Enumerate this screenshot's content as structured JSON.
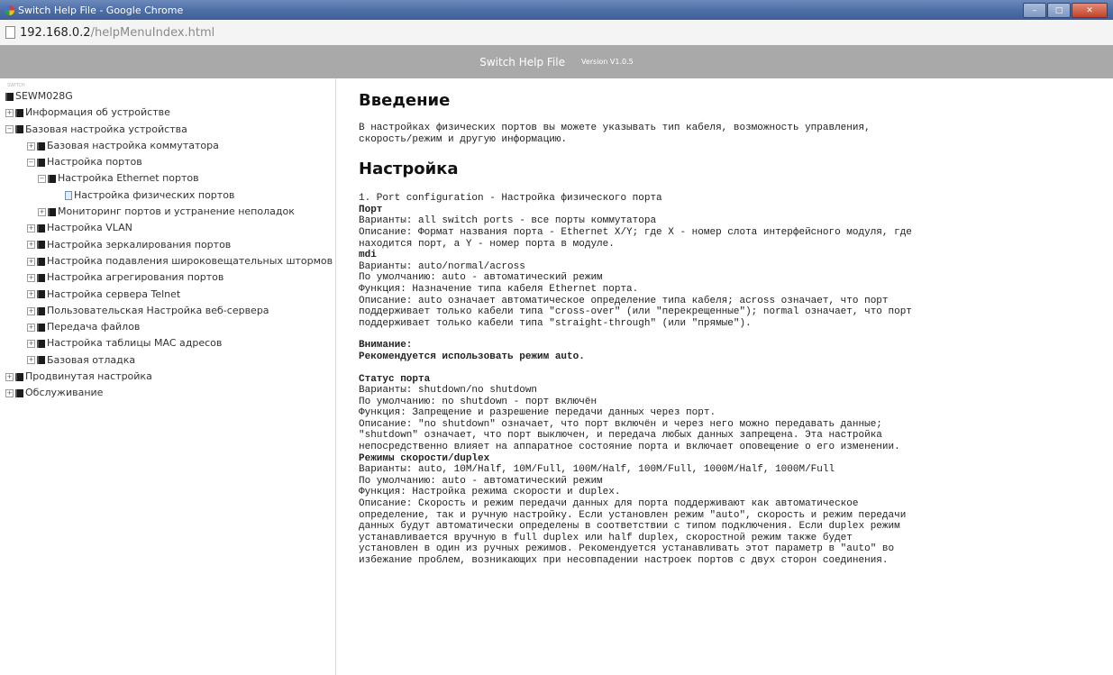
{
  "window": {
    "title": "Switch Help File - Google Chrome",
    "url_host": "192.168.0.2",
    "url_path": "/helpMenuIndex.html",
    "controls": [
      "–",
      "□",
      "✕"
    ]
  },
  "help_header": {
    "title": "Switch Help File",
    "version": "Version V1.0.5"
  },
  "sidebar": {
    "section_label": "SWITCH",
    "items": [
      {
        "label": "SEWM028G"
      },
      {
        "label": "Информация об устройстве"
      },
      {
        "label": "Базовая настройка устройства"
      },
      {
        "label": "Базовая настройка коммутатора"
      },
      {
        "label": "Настройка портов"
      },
      {
        "label": "Настройка Ethernet портов"
      },
      {
        "label": "Настройка физических портов"
      },
      {
        "label": "Мониторинг портов и устранение неполадок"
      },
      {
        "label": "Настройка VLAN"
      },
      {
        "label": "Настройка зеркалирования портов"
      },
      {
        "label": "Настройка подавления широковещательных штормов"
      },
      {
        "label": "Настройка агрегирования портов"
      },
      {
        "label": "Настройка сервера Telnet"
      },
      {
        "label": "Пользовательская Настройка веб-сервера"
      },
      {
        "label": "Передача файлов"
      },
      {
        "label": "Настройка таблицы MAC адресов"
      },
      {
        "label": "Базовая отладка"
      },
      {
        "label": "Продвинутая настройка"
      },
      {
        "label": "Обслуживание"
      }
    ]
  },
  "content": {
    "h1_intro": "Введение",
    "intro_1": "В настройках физических портов вы можете указывать тип кабеля, возможность управления,",
    "intro_2": "скорость/режим и другую информацию.",
    "h1_setup": "Настройка",
    "lines": [
      "1. Port configuration - Настройка физического порта",
      "Порт",
      "Варианты: all switch ports - все порты коммутатора",
      "Описание: Формат названия порта - Ethernet X/Y; где X - номер слота интерфейсного модуля, где",
      "находится порт, а Y - номер порта в модуле.",
      "mdi",
      "Варианты: auto/normal/across",
      "По умолчанию: auto - автоматический режим",
      "Функция: Назначение типа кабеля Ethernet порта.",
      "Описание: auto означает автоматическое определение типа кабеля; across означает, что порт",
      "поддерживает только кабели типа \"cross-over\" (или \"перекрещенные\"); normal означает, что порт",
      "поддерживает только кабели типа \"straight-through\" (или \"прямые\").",
      "",
      "Внимание:",
      "Рекомендуется использовать режим auto.",
      "",
      "Статус порта",
      "Варианты: shutdown/no shutdown",
      "По умолчанию: no shutdown - порт включён",
      "Функция: Запрещение и разрешение передачи данных через порт.",
      "Описание: \"no shutdown\" означает, что порт включён и через него можно передавать данные;",
      "\"shutdown\" означает, что порт выключен, и передача любых данных запрещена. Эта настройка",
      "непосредственно влияет на аппаратное состояние порта и включает оповещение о его изменении.",
      "Режимы скорости/duplex",
      "Варианты: auto, 10M/Half, 10M/Full, 100M/Half, 100M/Full, 1000M/Half, 1000M/Full",
      "По умолчанию: auto - автоматический режим",
      "Функция: Настройка режима скорости и duplex.",
      "Описание: Скорость и режим передачи данных для порта поддерживают как автоматическое",
      "определение, так и ручную настройку. Если установлен режим \"auto\", скорость и режим передачи",
      "данных будут автоматически определены в соответствии с типом подключения. Если duplex режим",
      "устанавливается вручную в full duplex или half duplex, скоростной режим также будет",
      "установлен в один из ручных режимов. Рекомендуется устанавливать этот параметр в \"auto\" во",
      "избежание проблем, возникающих при несовпадении настроек портов с двух сторон соединения."
    ]
  }
}
